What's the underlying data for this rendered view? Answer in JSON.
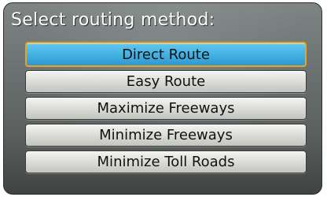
{
  "prompt": "Select routing method:",
  "options": [
    {
      "label": "Direct Route",
      "selected": true
    },
    {
      "label": "Easy Route",
      "selected": false
    },
    {
      "label": "Maximize Freeways",
      "selected": false
    },
    {
      "label": "Minimize Freeways",
      "selected": false
    },
    {
      "label": "Minimize Toll Roads",
      "selected": false
    }
  ],
  "colors": {
    "highlight": "#45b2e3",
    "highlight_border": "#e9a323",
    "background": "#6c7271"
  }
}
